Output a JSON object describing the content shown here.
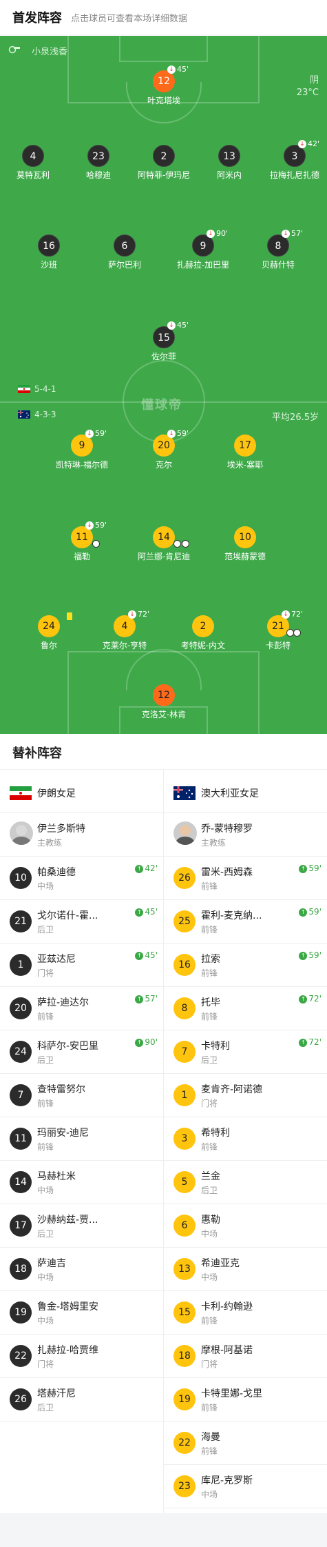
{
  "header": {
    "title": "首发阵容",
    "subtitle": "点击球员可查看本场详细数据"
  },
  "pitch": {
    "referee": "小泉浅香",
    "weather": "阴",
    "temperature": "23°C",
    "watermark": "懂球帝",
    "home_formation": "5-4-1",
    "away_formation": "4-3-3",
    "avg_age": "平均26.5岁"
  },
  "home_players": [
    {
      "number": "12",
      "name": "叶克塔埃",
      "sub": "45'",
      "gk": true
    },
    {
      "number": "4",
      "name": "莫特瓦利"
    },
    {
      "number": "23",
      "name": "哈穆迪"
    },
    {
      "number": "2",
      "name": "阿特菲-伊玛尼"
    },
    {
      "number": "13",
      "name": "阿米内"
    },
    {
      "number": "3",
      "name": "拉梅扎尼扎德",
      "sub": "42'"
    },
    {
      "number": "16",
      "name": "沙班"
    },
    {
      "number": "6",
      "name": "萨尔巴利"
    },
    {
      "number": "9",
      "name": "扎赫拉-加巴里",
      "sub": "90'"
    },
    {
      "number": "8",
      "name": "贝赫什特",
      "sub": "57'"
    },
    {
      "number": "15",
      "name": "佐尔菲",
      "sub": "45'"
    }
  ],
  "away_players": [
    {
      "number": "9",
      "name": "凯特琳-福尔德",
      "sub": "59'"
    },
    {
      "number": "20",
      "name": "克尔",
      "sub": "59'"
    },
    {
      "number": "17",
      "name": "埃米-塞耶"
    },
    {
      "number": "11",
      "name": "福勒",
      "sub": "59'"
    },
    {
      "number": "14",
      "name": "阿兰娜-肯尼迪"
    },
    {
      "number": "10",
      "name": "范埃赫蒙德"
    },
    {
      "number": "24",
      "name": "鲁尔"
    },
    {
      "number": "4",
      "name": "克莱尔-亨特",
      "sub": "72'"
    },
    {
      "number": "2",
      "name": "考特妮-内文"
    },
    {
      "number": "21",
      "name": "卡彭特",
      "sub": "72'"
    },
    {
      "number": "12",
      "name": "克洛艾-林肯",
      "gk": true
    }
  ],
  "subs": {
    "title": "替补阵容",
    "home": {
      "team": "伊朗女足",
      "coach": {
        "name": "伊兰多斯特",
        "role": "主教练"
      },
      "players": [
        {
          "number": "10",
          "name": "帕桑迪德",
          "pos": "中场",
          "in": "42'"
        },
        {
          "number": "21",
          "name": "戈尔诺什-霍...",
          "pos": "后卫",
          "in": "45'"
        },
        {
          "number": "1",
          "name": "亚兹达尼",
          "pos": "门将",
          "in": "45'"
        },
        {
          "number": "20",
          "name": "萨拉-迪达尔",
          "pos": "前锋",
          "in": "57'"
        },
        {
          "number": "24",
          "name": "科萨尔-安巴里",
          "pos": "后卫",
          "in": "90'"
        },
        {
          "number": "7",
          "name": "查特雷努尔",
          "pos": "前锋"
        },
        {
          "number": "11",
          "name": "玛丽安-迪尼",
          "pos": "前锋"
        },
        {
          "number": "14",
          "name": "马赫杜米",
          "pos": "中场"
        },
        {
          "number": "17",
          "name": "沙赫纳兹-贾...",
          "pos": "后卫"
        },
        {
          "number": "18",
          "name": "萨迪吉",
          "pos": "中场"
        },
        {
          "number": "19",
          "name": "鲁金-塔姆里安",
          "pos": "中场"
        },
        {
          "number": "22",
          "name": "扎赫拉-哈贾维",
          "pos": "门将"
        },
        {
          "number": "26",
          "name": "塔赫汗尼",
          "pos": "后卫"
        }
      ]
    },
    "away": {
      "team": "澳大利亚女足",
      "coach": {
        "name": "乔-蒙特穆罗",
        "role": "主教练"
      },
      "players": [
        {
          "number": "26",
          "name": "雷米-西姆森",
          "pos": "前锋",
          "in": "59'"
        },
        {
          "number": "25",
          "name": "霍利-麦克纳...",
          "pos": "前锋",
          "in": "59'"
        },
        {
          "number": "16",
          "name": "拉索",
          "pos": "前锋",
          "in": "59'"
        },
        {
          "number": "8",
          "name": "托毕",
          "pos": "前锋",
          "in": "72'"
        },
        {
          "number": "7",
          "name": "卡特利",
          "pos": "后卫",
          "in": "72'"
        },
        {
          "number": "1",
          "name": "麦肯齐-阿诺德",
          "pos": "门将"
        },
        {
          "number": "3",
          "name": "希特利",
          "pos": "前锋"
        },
        {
          "number": "5",
          "name": "兰金",
          "pos": "后卫"
        },
        {
          "number": "6",
          "name": "惠勒",
          "pos": "中场"
        },
        {
          "number": "13",
          "name": "希迪亚克",
          "pos": "中场"
        },
        {
          "number": "15",
          "name": "卡利-约翰逊",
          "pos": "前锋"
        },
        {
          "number": "18",
          "name": "摩根-阿基诺",
          "pos": "门将"
        },
        {
          "number": "19",
          "name": "卡特里娜-戈里",
          "pos": "前锋"
        },
        {
          "number": "22",
          "name": "海曼",
          "pos": "前锋"
        },
        {
          "number": "23",
          "name": "库尼-克罗斯",
          "pos": "中场"
        }
      ]
    }
  },
  "colors": {
    "pitch": "#3fa94a",
    "home": "#2b2b2b",
    "away": "#ffc40e",
    "gk": "#ff6a1a",
    "sub_in": "#3aa845",
    "sub_out": "#e53935"
  }
}
